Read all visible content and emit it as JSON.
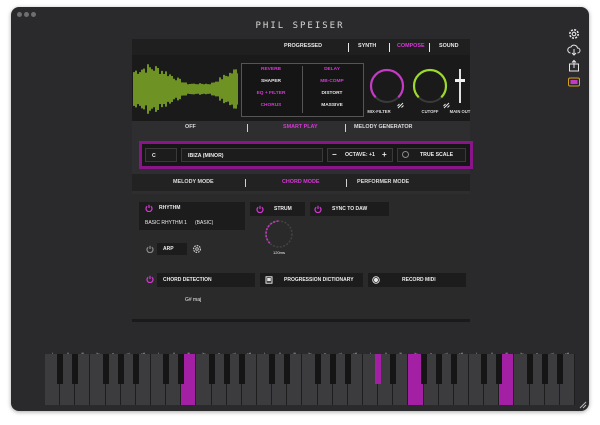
{
  "app": {
    "logo": "PHIL SPEISER"
  },
  "nav": {
    "items": [
      "PROGRESSED",
      "SYNTH",
      "COMPOSE",
      "SOUND"
    ],
    "active": "COMPOSE"
  },
  "fx": {
    "left": [
      "REVERB",
      "SHAPER",
      "EQ + FILTER",
      "CHORUS"
    ],
    "right": [
      "DELAY",
      "MB-COMP",
      "DISTORT",
      "MASSIVE"
    ]
  },
  "knobs": {
    "mix_filter": "MIX-FILTER",
    "cutoff": "CUTOFF",
    "main_out": "MAIN OUT"
  },
  "play_tabs": [
    "OFF",
    "SMART PLAY",
    "MELODY GENERATOR"
  ],
  "settings": {
    "key": "C",
    "scale": "IBIZA  (MINOR)",
    "minus": "−",
    "octave": "OCTAVE: +1",
    "plus": "+",
    "true_scale": "TRUE SCALE"
  },
  "mode_tabs": [
    "MELODY MODE",
    "CHORD MODE",
    "PERFORMER MODE"
  ],
  "rhythm": {
    "label": "RHYTHM",
    "value": "BASIC RHYTHM 1",
    "sub": "(BASIC)"
  },
  "strum": {
    "label": "STRUM",
    "time": "120ms"
  },
  "sync": {
    "label": "SYNC TO DAW"
  },
  "arp": {
    "label": "ARP"
  },
  "chord_detection": {
    "label": "CHORD DETECTION",
    "value": "G#  maj"
  },
  "progression": {
    "label": "PROGRESSION DICTIONARY"
  },
  "record": {
    "label": "RECORD MIDI"
  },
  "keyboard": {
    "degrees": [
      "i",
      "ii",
      "iii",
      "iv",
      "v",
      "vi",
      "vii"
    ],
    "active_degree": "vi",
    "octaves": 5
  },
  "colors": {
    "accent": "#d638d6",
    "dark_accent": "#8a158a",
    "key_active": "#a31fa3"
  }
}
